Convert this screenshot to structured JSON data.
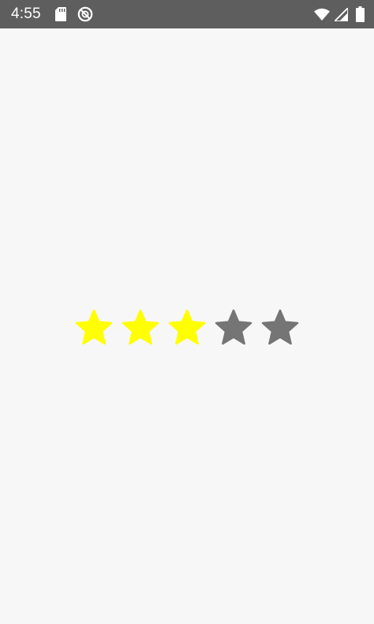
{
  "status_bar": {
    "time": "4:55",
    "icons": [
      "sd-card-icon",
      "do-not-disturb-icon",
      "wifi-icon",
      "cell-signal-icon",
      "battery-icon"
    ],
    "background_color": "#5e5e5e"
  },
  "rating": {
    "value": 3,
    "max": 5,
    "filled_color": "#ffff00",
    "empty_color": "#757575"
  },
  "background_color": "#f7f7f7"
}
